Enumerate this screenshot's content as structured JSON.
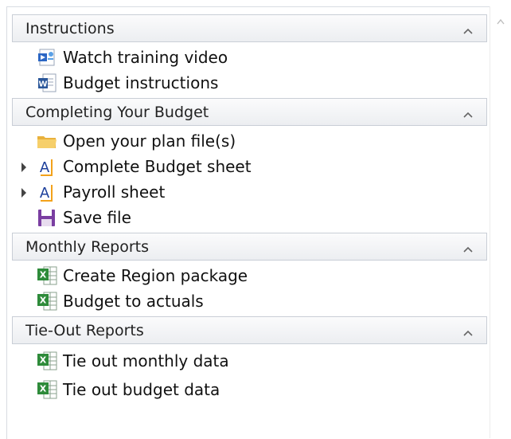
{
  "sections": [
    {
      "title": "Instructions",
      "items": [
        {
          "label": "Watch training video",
          "icon": "video-icon"
        },
        {
          "label": "Budget instructions",
          "icon": "word-document-icon"
        }
      ]
    },
    {
      "title": "Completing Your Budget",
      "items": [
        {
          "label": "Open your plan file(s)",
          "icon": "folder-icon"
        },
        {
          "label": "Complete Budget sheet",
          "icon": "text-a-icon"
        },
        {
          "label": "Payroll sheet",
          "icon": "text-a-icon"
        },
        {
          "label": "Save file",
          "icon": "save-icon"
        }
      ]
    },
    {
      "title": "Monthly Reports",
      "items": [
        {
          "label": "Create Region package",
          "icon": "excel-icon"
        },
        {
          "label": "Budget to actuals",
          "icon": "excel-icon"
        }
      ]
    },
    {
      "title": "Tie-Out Reports",
      "items": [
        {
          "label": "Tie out monthly data",
          "icon": "excel-icon"
        },
        {
          "label": "Tie out budget data",
          "icon": "excel-icon"
        }
      ]
    }
  ],
  "colors": {
    "header_border": "#c9ced6",
    "excel_green": "#2e8b3a",
    "word_blue": "#2b579a",
    "folder_yellow": "#f2c14e",
    "save_purple": "#7a3ea1",
    "text_a_blue": "#1c3f9b"
  }
}
